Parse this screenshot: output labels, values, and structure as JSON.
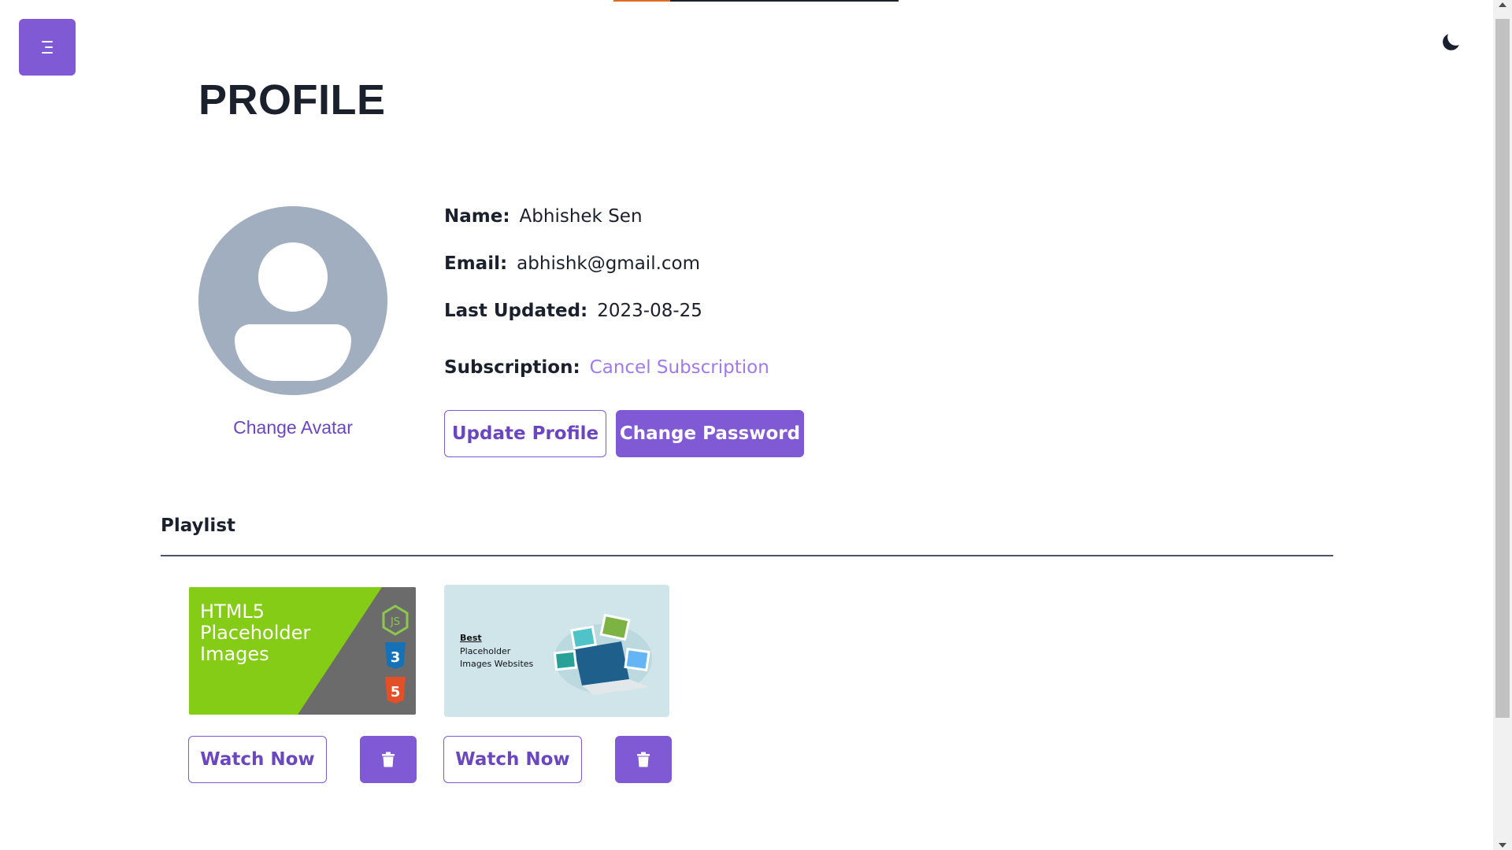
{
  "header": {
    "menu_icon": "menu-icon",
    "theme_icon": "moon-icon"
  },
  "page": {
    "title": "PROFILE"
  },
  "profile": {
    "avatar_icon": "user-avatar-icon",
    "change_avatar_label": "Change Avatar",
    "name_label": "Name:",
    "name_value": "Abhishek Sen",
    "email_label": "Email:",
    "email_value": "abhishk@gmail.com",
    "updated_label": "Last Updated:",
    "updated_value": "2023-08-25",
    "subscription_label": "Subscription:",
    "subscription_link": "Cancel Subscription",
    "update_button": "Update Profile",
    "password_button": "Change Password"
  },
  "playlist": {
    "heading": "Playlist",
    "items": [
      {
        "thumbnail_lines": [
          "HTML5",
          "Placeholder",
          "Images"
        ],
        "thumbnail_icons": [
          "nodejs-icon",
          "css3-icon",
          "html5-icon"
        ],
        "watch_label": "Watch Now",
        "delete_icon": "trash-icon"
      },
      {
        "thumbnail_title": "Best",
        "thumbnail_lines": [
          "Placeholder",
          "Images Websites"
        ],
        "watch_label": "Watch Now",
        "delete_icon": "trash-icon"
      }
    ]
  },
  "colors": {
    "accent": "#805ad5",
    "accent_text": "#6b46c1",
    "link": "#9f7aea",
    "avatar_bg": "#a0aec0",
    "text": "#1a202c",
    "loading_bar_accent": "#dd6b20"
  }
}
